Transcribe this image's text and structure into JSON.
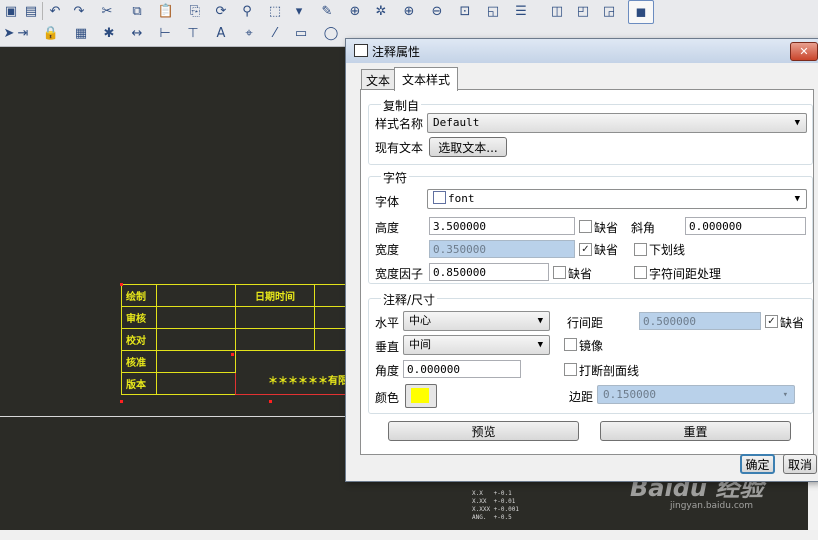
{
  "dialog": {
    "title": "注释属性",
    "close_glyph": "✕",
    "tabs": [
      "文本",
      "文本样式"
    ],
    "copy_group": {
      "label": "复制自",
      "style_name_label": "样式名称",
      "style_name_value": "Default",
      "existing_text_label": "现有文本",
      "pick_text_button": "选取文本..."
    },
    "char_group": {
      "label": "字符",
      "font_label": "字体",
      "font_value": "font",
      "height_label": "高度",
      "height_value": "3.500000",
      "height_default_label": "缺省",
      "slant_label": "斜角",
      "slant_value": "0.000000",
      "width_label": "宽度",
      "width_value": "0.350000",
      "width_default_label": "缺省",
      "underline_label": "下划线",
      "width_factor_label": "宽度因子",
      "width_factor_value": "0.850000",
      "width_factor_default_label": "缺省",
      "kerning_label": "字符间距处理"
    },
    "note_group": {
      "label": "注释/尺寸",
      "horizontal_label": "水平",
      "horizontal_value": "中心",
      "line_spacing_label": "行间距",
      "line_spacing_value": "0.500000",
      "line_spacing_default_label": "缺省",
      "vertical_label": "垂直",
      "vertical_value": "中间",
      "mirror_label": "镜像",
      "angle_label": "角度",
      "angle_value": "0.000000",
      "break_hatch_label": "打断剖面线",
      "color_label": "颜色",
      "color_value": "#ffff00",
      "margin_label": "边距",
      "margin_value": "0.150000"
    },
    "preview_button": "预览",
    "reset_button": "重置",
    "ok_button": "确定",
    "cancel_button": "取消"
  },
  "title_block": {
    "rows": [
      [
        "绘制",
        "",
        "日期时间",
        ""
      ],
      [
        "审核",
        "",
        "",
        ""
      ],
      [
        "校对",
        "",
        "",
        ""
      ],
      [
        "核准",
        "",
        "",
        ""
      ],
      [
        "版本",
        "",
        "",
        ""
      ]
    ],
    "company_text": "＊＊＊＊＊＊有限"
  },
  "tolerance_note": "X.X   +-0.1\nX.XX  +-0.01\nX.XXX +-0.001\nANG.  +-0.5",
  "watermark": {
    "main": "Baidu 经验",
    "sub": "jingyan.baidu.com"
  }
}
